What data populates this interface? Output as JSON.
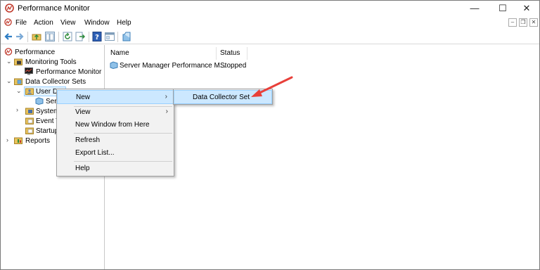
{
  "window": {
    "title": "Performance Monitor",
    "controls": {
      "minimize": "—",
      "maximize": "☐",
      "close": "✕"
    }
  },
  "menubar": {
    "items": [
      "File",
      "Action",
      "View",
      "Window",
      "Help"
    ],
    "mdi": {
      "minimize": "–",
      "restore": "❐",
      "close": "✕"
    }
  },
  "tree": {
    "performance": "Performance",
    "monitoring_tools": "Monitoring Tools",
    "performance_monitor": "Performance Monitor",
    "data_collector_sets": "Data Collector Sets",
    "user_defined": "User D",
    "server_manager_child": "Ser",
    "system": "System",
    "event_trace": "Event T",
    "startup": "Startup",
    "reports": "Reports"
  },
  "list": {
    "columns": [
      "Name",
      "Status"
    ],
    "rows": [
      {
        "name": "Server Manager Performance M...",
        "status": "Stopped"
      }
    ]
  },
  "context_menu": {
    "items": [
      {
        "label": "New",
        "has_submenu": true,
        "highlighted": true
      },
      {
        "label": "View",
        "has_submenu": true
      },
      {
        "label": "New Window from Here"
      },
      {
        "label": "Refresh"
      },
      {
        "label": "Export List..."
      },
      {
        "label": "Help"
      }
    ]
  },
  "submenu": {
    "items": [
      {
        "label": "Data Collector Set",
        "highlighted": true
      }
    ]
  },
  "colors": {
    "highlight_bg": "#cce8ff",
    "annotation_arrow": "#e8403a"
  }
}
